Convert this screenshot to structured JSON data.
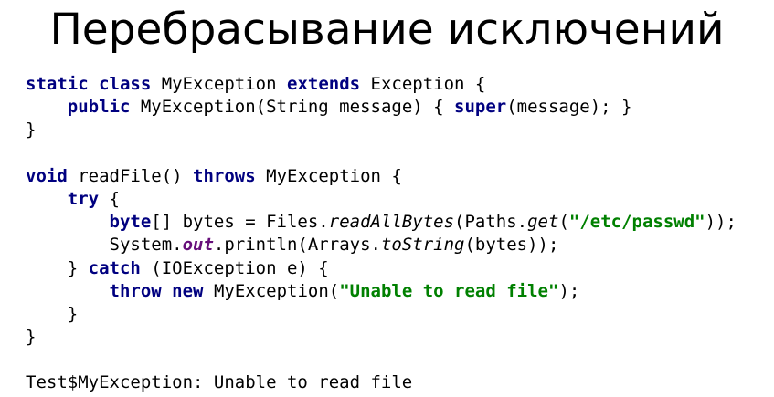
{
  "slide": {
    "title": "Перебрасывание исключений",
    "code_lines": [
      [
        {
          "t": "static",
          "c": "kw"
        },
        {
          "t": " ",
          "c": ""
        },
        {
          "t": "class",
          "c": "kw"
        },
        {
          "t": " MyException ",
          "c": ""
        },
        {
          "t": "extends",
          "c": "kw"
        },
        {
          "t": " Exception {",
          "c": ""
        }
      ],
      [
        {
          "t": "    ",
          "c": ""
        },
        {
          "t": "public",
          "c": "kw"
        },
        {
          "t": " MyException(String message) { ",
          "c": ""
        },
        {
          "t": "super",
          "c": "kw"
        },
        {
          "t": "(message); }",
          "c": ""
        }
      ],
      [
        {
          "t": "}",
          "c": ""
        }
      ],
      [],
      [
        {
          "t": "void",
          "c": "kw"
        },
        {
          "t": " readFile() ",
          "c": ""
        },
        {
          "t": "throws",
          "c": "kw"
        },
        {
          "t": " MyException {",
          "c": ""
        }
      ],
      [
        {
          "t": "    ",
          "c": ""
        },
        {
          "t": "try",
          "c": "kw"
        },
        {
          "t": " {",
          "c": ""
        }
      ],
      [
        {
          "t": "        ",
          "c": ""
        },
        {
          "t": "byte",
          "c": "kw"
        },
        {
          "t": "[] bytes = Files.",
          "c": ""
        },
        {
          "t": "readAllBytes",
          "c": "it"
        },
        {
          "t": "(Paths.",
          "c": ""
        },
        {
          "t": "get",
          "c": "it"
        },
        {
          "t": "(",
          "c": ""
        },
        {
          "t": "\"/etc/passwd\"",
          "c": "str"
        },
        {
          "t": "));",
          "c": ""
        }
      ],
      [
        {
          "t": "        System.",
          "c": ""
        },
        {
          "t": "out",
          "c": "fld"
        },
        {
          "t": ".println(Arrays.",
          "c": ""
        },
        {
          "t": "toString",
          "c": "it"
        },
        {
          "t": "(bytes));",
          "c": ""
        }
      ],
      [
        {
          "t": "    } ",
          "c": ""
        },
        {
          "t": "catch",
          "c": "kw"
        },
        {
          "t": " (IOException e) {",
          "c": ""
        }
      ],
      [
        {
          "t": "        ",
          "c": ""
        },
        {
          "t": "throw",
          "c": "kw"
        },
        {
          "t": " ",
          "c": ""
        },
        {
          "t": "new",
          "c": "kw"
        },
        {
          "t": " MyException(",
          "c": ""
        },
        {
          "t": "\"Unable to read file\"",
          "c": "str"
        },
        {
          "t": ");",
          "c": ""
        }
      ],
      [
        {
          "t": "    }",
          "c": ""
        }
      ],
      [
        {
          "t": "}",
          "c": ""
        }
      ],
      [],
      [
        {
          "t": "Test$MyException: Unable to read file",
          "c": ""
        }
      ]
    ]
  },
  "syntax_colors": {
    "keyword": "#000080",
    "string": "#008000",
    "static_field": "#660e7a",
    "text": "#000000",
    "background": "#ffffff"
  }
}
